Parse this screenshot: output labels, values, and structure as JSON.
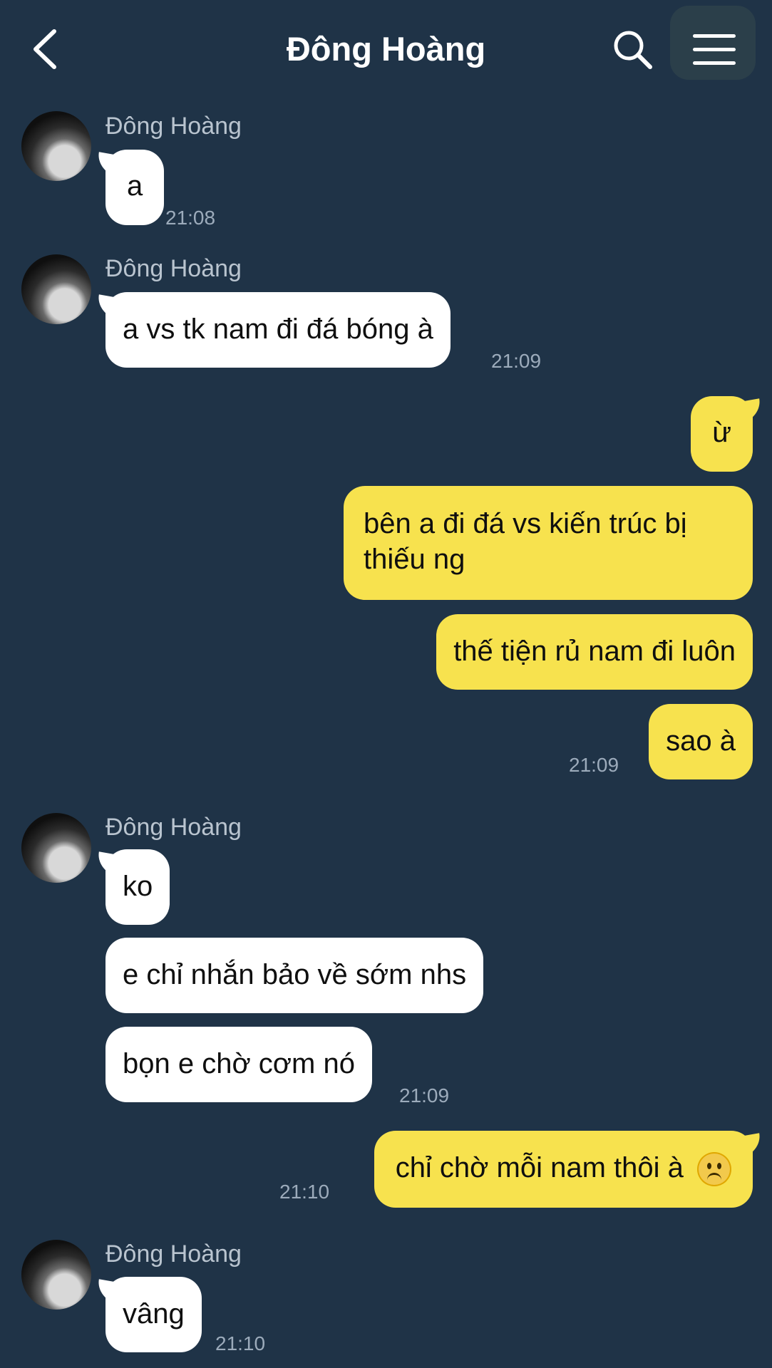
{
  "header": {
    "title": "Đông Hoàng",
    "back_icon": "chevron-left-icon",
    "search_icon": "search-icon",
    "menu_icon": "hamburger-menu-icon"
  },
  "colors": {
    "background": "#1f3347",
    "incoming_bubble": "#ffffff",
    "outgoing_bubble": "#f7e24e",
    "timestamp": "#9cabbb",
    "sender_name": "#b9c4cf"
  },
  "conversation": {
    "group1": {
      "sender": "Đông Hoàng",
      "messages": [
        "a"
      ],
      "time": "21:08"
    },
    "group2": {
      "sender": "Đông Hoàng",
      "messages": [
        "a vs tk nam đi đá bóng à"
      ],
      "time": "21:09"
    },
    "group3": {
      "messages": [
        "ừ",
        "bên a đi đá vs kiến trúc bị thiếu ng",
        "thế tiện rủ nam đi luôn",
        "sao à"
      ],
      "time": "21:09"
    },
    "group4": {
      "sender": "Đông Hoàng",
      "messages": [
        "ko",
        "e chỉ nhắn bảo về sớm nhs",
        "bọn e chờ cơm nó"
      ],
      "time": "21:09"
    },
    "group5": {
      "messages": [
        "chỉ chờ mỗi nam thôi à"
      ],
      "emoji": "sad-face-emoji",
      "time": "21:10"
    },
    "group6": {
      "sender": "Đông Hoàng",
      "messages": [
        "vâng"
      ],
      "time": "21:10"
    }
  }
}
